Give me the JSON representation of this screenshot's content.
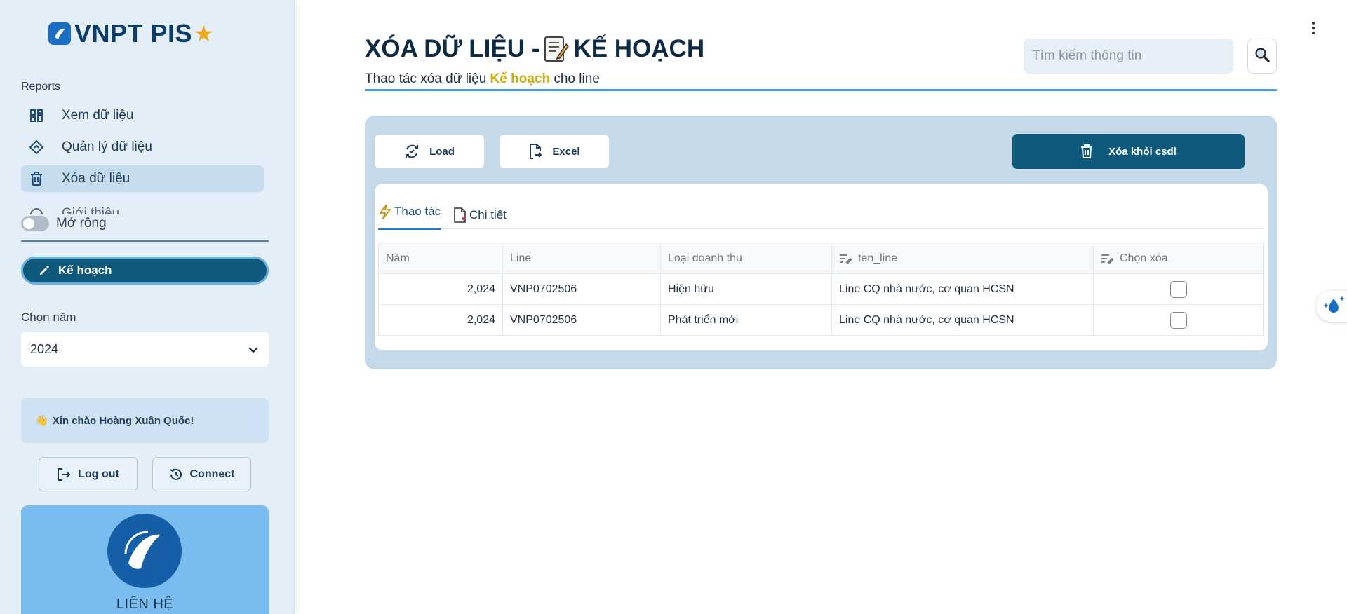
{
  "sidebar": {
    "logo": "VNPT PIS",
    "section_label": "Reports",
    "items": [
      {
        "label": "Xem dữ liệu",
        "icon": "dashboard-icon"
      },
      {
        "label": "Quản lý dữ liệu",
        "icon": "diamond-nav-icon"
      },
      {
        "label": "Xóa dữ liệu",
        "icon": "trash-icon"
      },
      {
        "label": "Giới thiệu",
        "icon": "info-icon"
      }
    ],
    "toggle_label": "Mở rộng",
    "plan_button": "Kế hoạch",
    "year_label": "Chọn năm",
    "year_value": "2024",
    "greeting": "Xin chào Hoàng Xuân Quốc!",
    "logout": "Log out",
    "connect": "Connect",
    "contact_title": "LIÊN HỆ"
  },
  "header": {
    "title_prefix": "XÓA DỮ LIỆU -",
    "title_suffix": "KẾ HOẠCH",
    "subtitle_before": "Thao tác xóa dữ liệu",
    "subtitle_highlight": "Kế hoạch",
    "subtitle_after": "cho line",
    "search_placeholder": "Tìm kiếm thông tin"
  },
  "toolbar": {
    "load": "Load",
    "excel": "Excel",
    "delete": "Xóa khỏi csdl"
  },
  "tabs": [
    {
      "label": "Thao tác",
      "active": true
    },
    {
      "label": "Chi tiết",
      "active": false
    }
  ],
  "table": {
    "columns": [
      "Năm",
      "Line",
      "Loại doanh thu",
      "ten_line",
      "Chọn xóa"
    ],
    "rows": [
      {
        "nam": "2,024",
        "line": "VNP0702506",
        "loai": "Hiện hữu",
        "ten_line": "Line CQ nhà nước, cơ quan HCSN",
        "chon": false
      },
      {
        "nam": "2,024",
        "line": "VNP0702506",
        "loai": "Phát triển mới",
        "ten_line": "Line CQ nhà nước, cơ quan HCSN",
        "chon": false
      }
    ]
  },
  "colors": {
    "accent": "#0e5a7d",
    "sidebar_bg": "#e3eef8",
    "panel_bg": "#c5d9e8",
    "highlight": "#c9ac0e"
  }
}
